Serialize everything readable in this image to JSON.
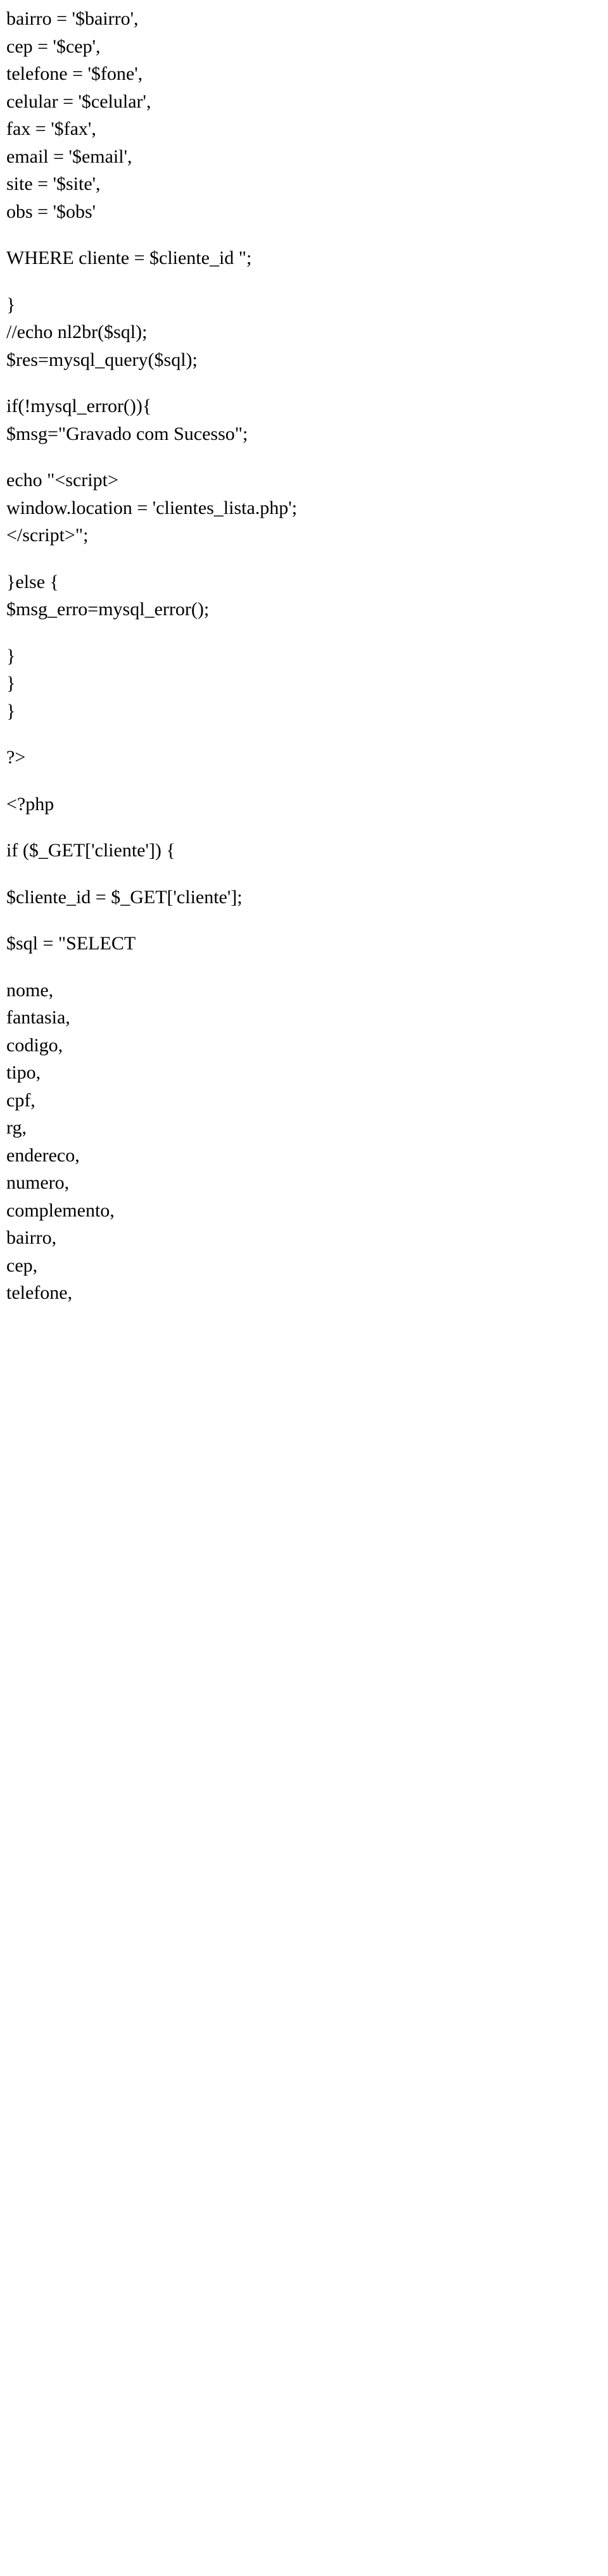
{
  "lines": {
    "l1": "bairro = '$bairro',",
    "l2": "cep = '$cep',",
    "l3": "telefone = '$fone',",
    "l4": "celular = '$celular',",
    "l5": "fax = '$fax',",
    "l6": "email = '$email',",
    "l7": "site = '$site',",
    "l8": "obs = '$obs'",
    "l9": "WHERE cliente = $cliente_id \";",
    "l10": "}",
    "l11": "//echo nl2br($sql);",
    "l12": "$res=mysql_query($sql);",
    "l13": "if(!mysql_error()){",
    "l14": "$msg=\"Gravado com Sucesso\";",
    "l15": "echo \"<script>",
    "l16": "window.location = 'clientes_lista.php';",
    "l17": "</script>\";",
    "l18": "}else {",
    "l19": "$msg_erro=mysql_error();",
    "l20": "}",
    "l21": "}",
    "l22": "}",
    "l23": "?>",
    "l24": "<?php",
    "l25": "if ($_GET['cliente']) {",
    "l26": "$cliente_id = $_GET['cliente'];",
    "l27": "$sql = \"SELECT",
    "l28": "nome,",
    "l29": "fantasia,",
    "l30": "codigo,",
    "l31": "tipo,",
    "l32": "cpf,",
    "l33": "rg,",
    "l34": "endereco,",
    "l35": "numero,",
    "l36": "complemento,",
    "l37": "bairro,",
    "l38": "cep,",
    "l39": "telefone,"
  }
}
